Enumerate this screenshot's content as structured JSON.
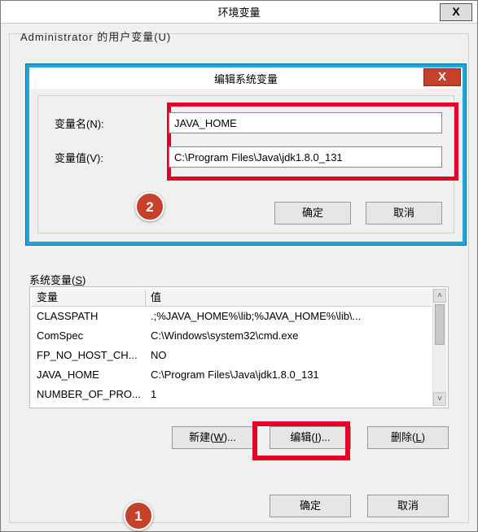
{
  "backWindow": {
    "title": "环境变量",
    "closeGlyph": "X",
    "userVarsLabel": "Administrator 的用户变量(U)"
  },
  "editDialog": {
    "title": "编辑系统变量",
    "closeGlyph": "X",
    "nameLabel": "变量名(N):",
    "nameValue": "JAVA_HOME",
    "valueLabel": "变量值(V):",
    "valueValue": "C:\\Program Files\\Java\\jdk1.8.0_131",
    "okLabel": "确定",
    "cancelLabel": "取消"
  },
  "badges": {
    "one": "1",
    "two": "2"
  },
  "sysVars": {
    "groupLabel": "系统变量(",
    "groupLabelKey": "S",
    "groupLabelEnd": ")",
    "headerVar": "变量",
    "headerVal": "值",
    "rows": [
      {
        "name": "CLASSPATH",
        "value": ".;%JAVA_HOME%\\lib;%JAVA_HOME%\\lib\\..."
      },
      {
        "name": "ComSpec",
        "value": "C:\\Windows\\system32\\cmd.exe"
      },
      {
        "name": "FP_NO_HOST_CH...",
        "value": "NO"
      },
      {
        "name": "JAVA_HOME",
        "value": "C:\\Program Files\\Java\\jdk1.8.0_131"
      },
      {
        "name": "NUMBER_OF_PRO...",
        "value": "1"
      }
    ],
    "newLabel": "新建(",
    "newKey": "W",
    "newEnd": ")...",
    "editLabel": "编辑(",
    "editKey": "I",
    "editEnd": ")...",
    "deleteLabel": "删除(",
    "deleteKey": "L",
    "deleteEnd": ")"
  },
  "mainButtons": {
    "ok": "确定",
    "cancel": "取消"
  },
  "scroll": {
    "up": "˄",
    "down": "˅"
  }
}
